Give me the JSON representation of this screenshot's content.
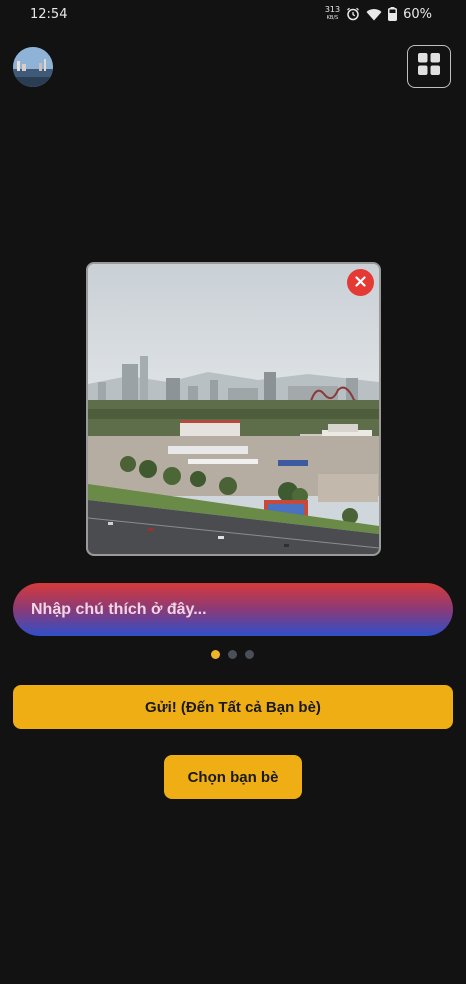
{
  "status_bar": {
    "time": "12:54",
    "network_label_top": "313",
    "network_label_bottom": "KB/S",
    "battery": "60%"
  },
  "header": {
    "avatar_icon": "profile-avatar",
    "menu_icon": "grid-icon"
  },
  "photo": {
    "subject": "city skyline photo",
    "remove_icon": "close-icon",
    "remove_color": "#e53935"
  },
  "caption": {
    "placeholder": "Nhập chú thích ở đây..."
  },
  "pager": {
    "active_index": 0,
    "active_color": "#f0b429"
  },
  "actions": {
    "send_label": "Gửi! (Đến Tất cả Bạn bè)",
    "choose_friends_label": "Chọn bạn bè",
    "accent": "#eeae14"
  }
}
